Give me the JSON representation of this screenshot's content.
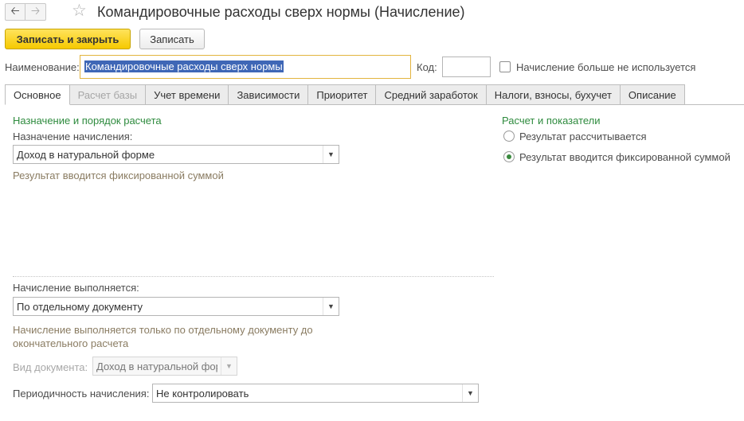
{
  "header": {
    "title": "Командировочные расходы сверх нормы (Начисление)",
    "back_icon": "arrow-left-icon",
    "forward_icon": "arrow-right-icon",
    "favorite_icon": "star-icon"
  },
  "toolbar": {
    "save_close_label": "Записать и закрыть",
    "save_label": "Записать"
  },
  "form": {
    "name_label": "Наименование:",
    "name_value": "Командировочные расходы сверх нормы",
    "code_label": "Код:",
    "code_value": "",
    "unused_checkbox_label": "Начисление больше не используется",
    "unused_checked": false
  },
  "tabs": [
    {
      "label": "Основное",
      "active": true,
      "disabled": false
    },
    {
      "label": "Расчет базы",
      "active": false,
      "disabled": true
    },
    {
      "label": "Учет времени",
      "active": false,
      "disabled": false
    },
    {
      "label": "Зависимости",
      "active": false,
      "disabled": false
    },
    {
      "label": "Приоритет",
      "active": false,
      "disabled": false
    },
    {
      "label": "Средний заработок",
      "active": false,
      "disabled": false
    },
    {
      "label": "Налоги, взносы, бухучет",
      "active": false,
      "disabled": false
    },
    {
      "label": "Описание",
      "active": false,
      "disabled": false
    }
  ],
  "main": {
    "purpose_section": "Назначение и порядок расчета",
    "purpose_label": "Назначение начисления:",
    "purpose_value": "Доход в натуральной форме",
    "purpose_note": "Результат вводится фиксированной суммой",
    "execution_label": "Начисление выполняется:",
    "execution_value": "По отдельному документу",
    "execution_note_line1": "Начисление выполняется только по отдельному документу до",
    "execution_note_line2": "окончательного расчета",
    "doc_type_label": "Вид документа:",
    "doc_type_value": "Доход в натуральной фор",
    "periodicity_label": "Периодичность начисления:",
    "periodicity_value": "Не контролировать"
  },
  "calc": {
    "section": "Расчет и показатели",
    "option_calculated": "Результат рассчитывается",
    "option_fixed": "Результат вводится фиксированной суммой",
    "selected": "fixed"
  },
  "colors": {
    "accent_yellow": "#f6c900",
    "section_green": "#2e8b3e",
    "note_brown": "#8a7c62",
    "selection_blue": "#3f67b6"
  }
}
